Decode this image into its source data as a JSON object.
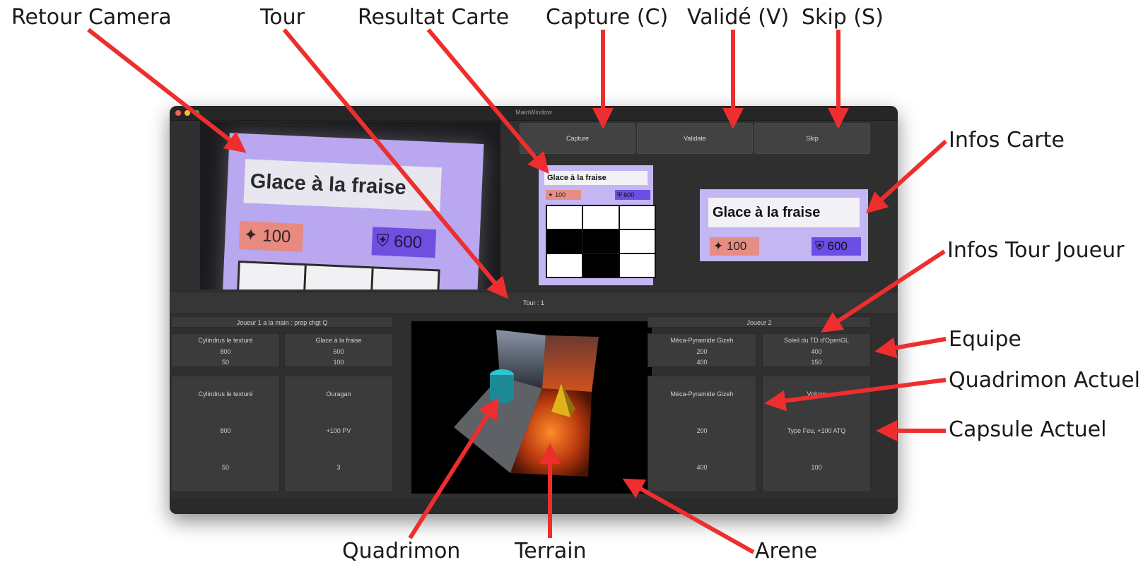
{
  "callouts": {
    "retour_camera": "Retour Camera",
    "tour": "Tour",
    "resultat_carte": "Resultat Carte",
    "capture": "Capture (C)",
    "valide": "Validé (V)",
    "skip": "Skip (S)",
    "infos_carte": "Infos Carte",
    "infos_tour_joueur": "Infos Tour Joueur",
    "equipe": "Equipe",
    "quadrimon_actuel": "Quadrimon Actuel",
    "capsule_actuel": "Capsule Actuel",
    "quadrimon": "Quadrimon",
    "terrain": "Terrain",
    "arene": "Arene"
  },
  "window": {
    "title": "MainWindow"
  },
  "camera_card": {
    "name": "Glace à la fraise",
    "attack": "100",
    "defense": "600"
  },
  "toolbar": {
    "capture_label": "Capture",
    "validate_label": "Validate",
    "skip_label": "Skip"
  },
  "result_card": {
    "name": "Glace à la fraise",
    "attack": "100",
    "defense": "600",
    "grid": [
      0,
      0,
      0,
      1,
      1,
      0,
      0,
      1,
      0
    ]
  },
  "info_card": {
    "name": "Glace à la fraise",
    "attack": "100",
    "defense": "600"
  },
  "turn": {
    "label": "Tour : 1"
  },
  "player1": {
    "header": "Joueur 1 a la main : prep chgt Q",
    "team": [
      {
        "name": "Cylindrus le texturé",
        "hp": "800",
        "atk": "50"
      },
      {
        "name": "Glace à la fraise",
        "hp": "600",
        "atk": "100"
      }
    ],
    "current_quadrimon": {
      "name": "Cylindrus le texturé",
      "hp": "800",
      "atk": "50"
    },
    "current_capsule": {
      "name": "Ouragan",
      "effect": "+100 PV",
      "value": "3"
    }
  },
  "player2": {
    "header": "Joueur 2",
    "team": [
      {
        "name": "Méca-Pyramide Gizeh",
        "hp": "200",
        "atk": "400"
      },
      {
        "name": "Soleil du TD d'OpenGL",
        "hp": "400",
        "atk": "150"
      }
    ],
    "current_quadrimon": {
      "name": "Méca-Pyramide Gizeh",
      "hp": "200",
      "atk": "400"
    },
    "current_capsule": {
      "name": "Volcan",
      "effect": "Type Feu, +100 ATQ",
      "value": "100"
    }
  },
  "colors": {
    "accent_arrow": "#ee2e2e",
    "card_bg": "#c4b5f3",
    "attack_badge": "#e78d84",
    "defense_badge": "#6a4ee6",
    "window_bg": "#2f2f2f"
  }
}
